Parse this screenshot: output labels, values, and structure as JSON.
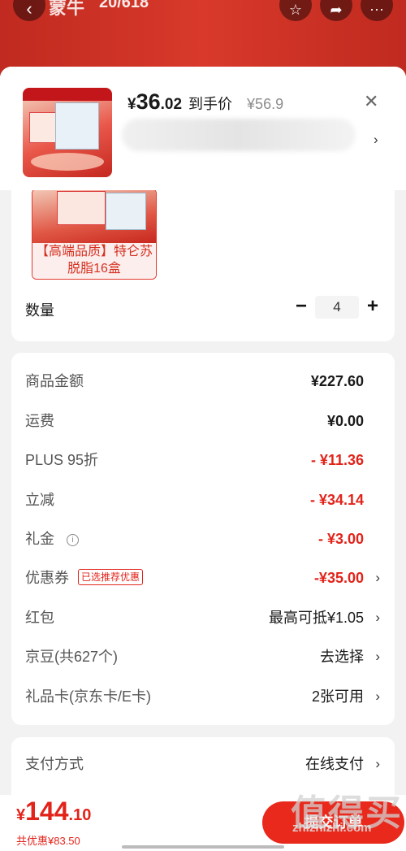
{
  "topbar": {
    "title": "蒙牛",
    "page_counter": "20/618"
  },
  "colors": {
    "accent": "#e2231a",
    "bg": "#f2f2f2"
  },
  "product": {
    "price_yen": "¥",
    "price_int": "36",
    "price_dec": ".02",
    "price_label": "到手价",
    "original_price": "¥56.9",
    "spec_option_text": "【高端品质】特仑苏脱脂16盒"
  },
  "quantity": {
    "label": "数量",
    "value": "4",
    "minus": "−",
    "plus": "+"
  },
  "costs": [
    {
      "label": "商品金额",
      "value": "¥227.60"
    },
    {
      "label": "运费",
      "value": "¥0.00"
    },
    {
      "label": "PLUS  95折",
      "value": "- ¥11.36"
    },
    {
      "label": "立减",
      "value": "- ¥34.14"
    },
    {
      "label": "礼金",
      "value": "- ¥3.00"
    },
    {
      "label": "优惠券",
      "tag": "已选推荐优惠",
      "value": "-¥35.00"
    },
    {
      "label": "红包",
      "value": "最高可抵¥1.05"
    },
    {
      "label": "京豆(共627个)",
      "value": "去选择"
    },
    {
      "label": "礼品卡(京东卡/E卡)",
      "value": "2张可用"
    }
  ],
  "payment": {
    "label": "支付方式",
    "value": "在线支付"
  },
  "footer": {
    "total_yen": "¥",
    "total_int": "144",
    "total_dec": ".10",
    "saved": "共优惠¥83.50",
    "submit": "提交订单",
    "watermark": "值得买",
    "watermark_url": "zhizhizhi.com"
  }
}
